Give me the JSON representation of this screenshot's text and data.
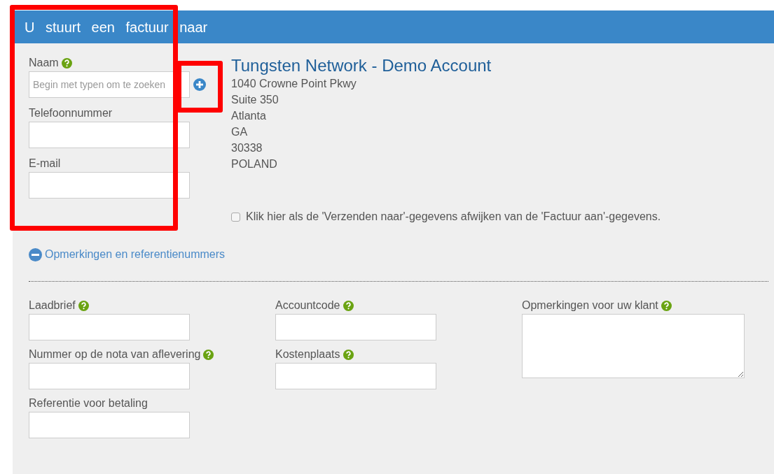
{
  "header": {
    "title": "U stuurt een factuur naar"
  },
  "contact_fields": [
    {
      "label": "Naam",
      "help": true,
      "placeholder": "Begin met typen om te zoeken",
      "add_button": true
    },
    {
      "label": "Telefoonnummer",
      "help": false,
      "add_button": false
    },
    {
      "label": "E-mail",
      "help": false,
      "add_button": false
    }
  ],
  "recipient": {
    "name": "Tungsten Network - Demo Account",
    "address_lines": [
      "1040 Crowne Point Pkwy",
      "Suite 350",
      "Atlanta",
      "GA",
      "30338",
      "POLAND"
    ]
  },
  "shipping_checkbox": {
    "label": "Klik hier als de 'Verzenden naar'-gegevens afwijken van de 'Factuur aan'-gegevens.",
    "checked": false
  },
  "references_toggle": {
    "label": "Opmerkingen en referentienummers",
    "expanded": true
  },
  "reference_columns": [
    [
      {
        "label": "Laadbrief",
        "help": true,
        "kind": "input"
      },
      {
        "label": "Nummer op de nota van aflevering",
        "help": true,
        "kind": "input"
      },
      {
        "label": "Referentie voor betaling",
        "help": false,
        "kind": "input"
      }
    ],
    [
      {
        "label": "Accountcode",
        "help": true,
        "kind": "input"
      },
      {
        "label": "Kostenplaats",
        "help": true,
        "kind": "input"
      }
    ],
    [
      {
        "label": "Opmerkingen voor uw klant",
        "help": true,
        "kind": "textarea"
      }
    ]
  ],
  "highlights": {
    "contact_fields": true,
    "add_button": true
  }
}
